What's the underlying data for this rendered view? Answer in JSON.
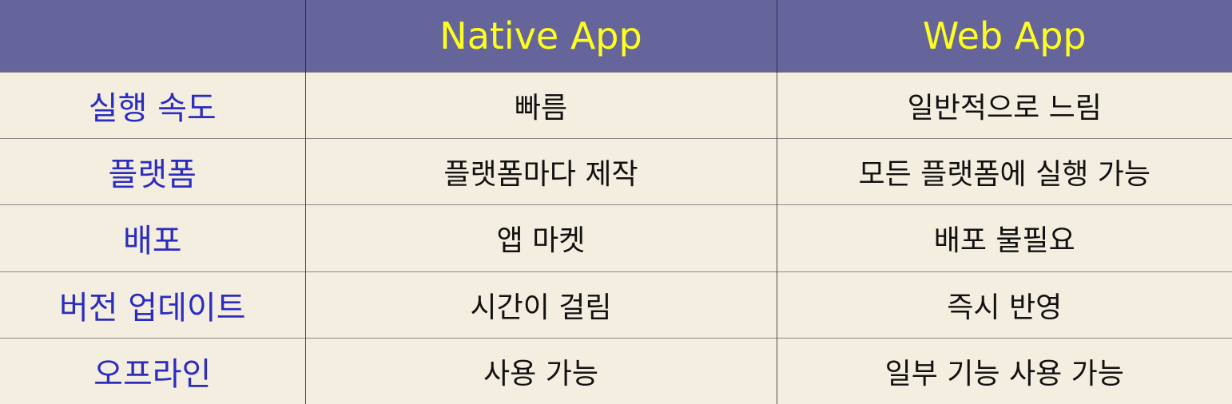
{
  "header": {
    "corner": "",
    "native": "Native App",
    "web": "Web App"
  },
  "rows": [
    {
      "label": "실행 속도",
      "native": "빠름",
      "web": "일반적으로 느림"
    },
    {
      "label": "플랫폼",
      "native": "플랫폼마다 제작",
      "web": "모든 플랫폼에 실행 가능"
    },
    {
      "label": "배포",
      "native": "앱 마켓",
      "web": "배포 불필요"
    },
    {
      "label": "버전 업데이트",
      "native": "시간이 걸림",
      "web": "즉시 반영"
    },
    {
      "label": "오프라인",
      "native": "사용 가능",
      "web": "일부 기능 사용 가능"
    }
  ],
  "colors": {
    "header_bg": "#65659b",
    "header_text": "#ffff1f",
    "body_bg": "#f3eee0",
    "label_text": "#2c2cbe"
  }
}
